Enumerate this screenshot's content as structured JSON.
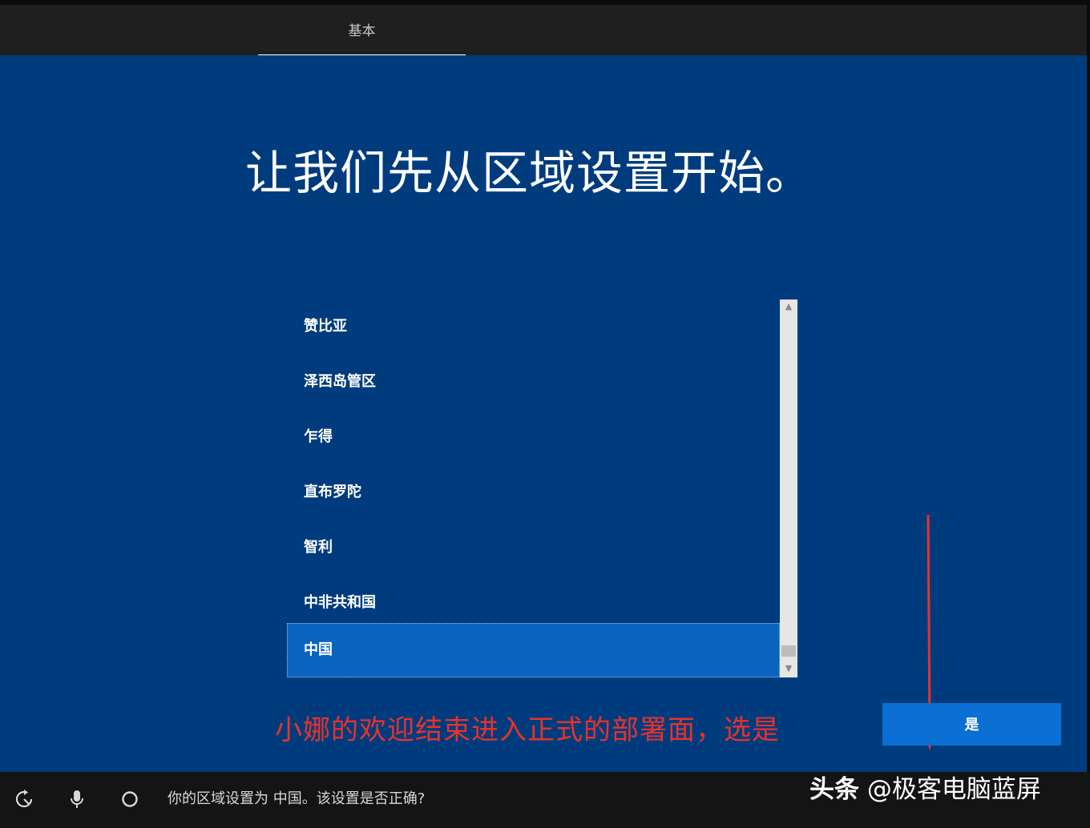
{
  "header": {
    "tab_label": "基本"
  },
  "main": {
    "title": "让我们先从区域设置开始。",
    "region_list": [
      {
        "label": "赞比亚",
        "selected": false
      },
      {
        "label": "泽西岛管区",
        "selected": false
      },
      {
        "label": "乍得",
        "selected": false
      },
      {
        "label": "直布罗陀",
        "selected": false
      },
      {
        "label": "智利",
        "selected": false
      },
      {
        "label": "中非共和国",
        "selected": false
      },
      {
        "label": "中国",
        "selected": true
      }
    ],
    "annotation": "小娜的欢迎结束进入正式的部署面，选是",
    "yes_button": "是"
  },
  "bottom": {
    "status_text": "你的区域设置为 中国。该设置是否正确?",
    "icons": [
      "ease-of-access-icon",
      "microphone-icon",
      "cortana-circle-icon"
    ]
  },
  "watermark": {
    "source": "头条",
    "author": "@极客电脑蓝屏"
  },
  "colors": {
    "main_bg": "#003c7d",
    "selected_item": "#0a63bf",
    "button": "#0b6fd3",
    "annotation": "#e8322a"
  }
}
